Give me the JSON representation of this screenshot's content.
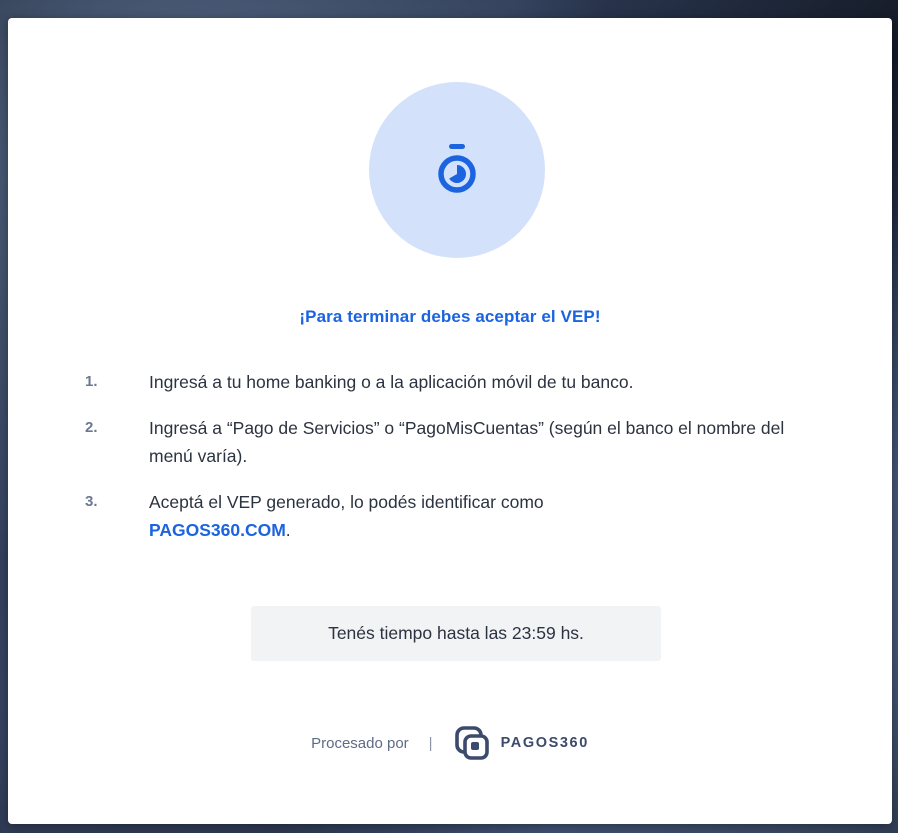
{
  "modal": {
    "icon": "stopwatch-icon",
    "title": "¡Para terminar debes aceptar el VEP!",
    "steps": [
      {
        "number": "1.",
        "text": "Ingresá a tu home banking o a la aplicación móvil de tu banco."
      },
      {
        "number": "2.",
        "text": "Ingresá a “Pago de Servicios” o “PagoMisCuentas” (según el banco el nombre del menú varía)."
      },
      {
        "number": "3.",
        "text": "Aceptá el VEP generado, lo podés identificar como ",
        "link": "PAGOS360.COM",
        "suffix": "."
      }
    ],
    "time_notice": "Tenés tiempo hasta las 23:59 hs.",
    "footer": {
      "processed_by": "Procesado por",
      "separator": "|",
      "brand_name": "PAGOS360",
      "brand_icon": "pagos360-logo-icon"
    }
  },
  "colors": {
    "accent": "#1c63e0",
    "icon_circle_bg": "#d3e1fb",
    "text": "#2c3340",
    "step_number": "#6c7892",
    "time_box_bg": "#f2f3f5",
    "brand_text": "#3c4a6b"
  }
}
